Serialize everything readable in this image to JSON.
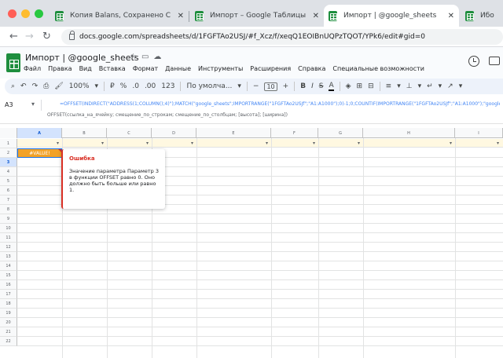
{
  "browser": {
    "tabs": [
      {
        "label": "Копия Balans, Сохранено С",
        "close": "✕"
      },
      {
        "label": "Импорт – Google Таблицы",
        "close": "✕"
      },
      {
        "label": "Импорт | @google_sheets",
        "close": "✕"
      },
      {
        "label": "Ибо",
        "close": ""
      }
    ],
    "url": "docs.google.com/spreadsheets/d/1FGFTAo2USJ/#f_Xcz/f/xeqQ1EOIBnUQPzTQOT/YPk6/edit#gid=0"
  },
  "sheets": {
    "title": "Импорт | @google_sheets",
    "menu": [
      "Файл",
      "Правка",
      "Вид",
      "Вставка",
      "Формат",
      "Данные",
      "Инструменты",
      "Расширения",
      "Справка",
      "Специальные возможности"
    ]
  },
  "toolbar": {
    "zoom": "100%",
    "currency": "₽",
    "percent": "%",
    "decimal_dec": ".0",
    "decimal_inc": ".00",
    "number_format": "123",
    "font": "По умолча...",
    "font_size": "10",
    "bold": "B",
    "italic": "I",
    "strike": "S",
    "text_color": "A"
  },
  "formula_bar": {
    "cell_ref": "A3",
    "formula": "=OFFSET(INDIRECT(\"ADDRESS(1;COLUMN();4)\");MATCH(\"google_sheets\";IMPORTRANGE(\"1FGFTAo2USJf\";\"A1:A1000\");0)-1;0;COUNTIF(IMPORTRANGE(\"1FGFTAo2USJf\";\"A1:A1000\");\"google_sheets\");1)",
    "hint": "OFFSET(ссылка_на_ячейку; смещение_по_строкам; смещение_по_столбцам; [высота]; [ширина])"
  },
  "grid": {
    "columns": [
      "A",
      "B",
      "C",
      "D",
      "E",
      "F",
      "G",
      "H",
      "I"
    ],
    "rows": [
      "1",
      "2",
      "3",
      "4",
      "5",
      "6",
      "7",
      "8",
      "9",
      "10",
      "11",
      "12",
      "13",
      "14",
      "15",
      "16",
      "17",
      "18",
      "19",
      "20",
      "21",
      "22"
    ],
    "selected_cell_value": "#VALUE!",
    "filter_icon": "▾"
  },
  "error_popup": {
    "title": "Ошибка",
    "message": "Значение параметра Параметр 3 в функции OFFSET равно 0. Оно должно быть больше или равно 1."
  }
}
